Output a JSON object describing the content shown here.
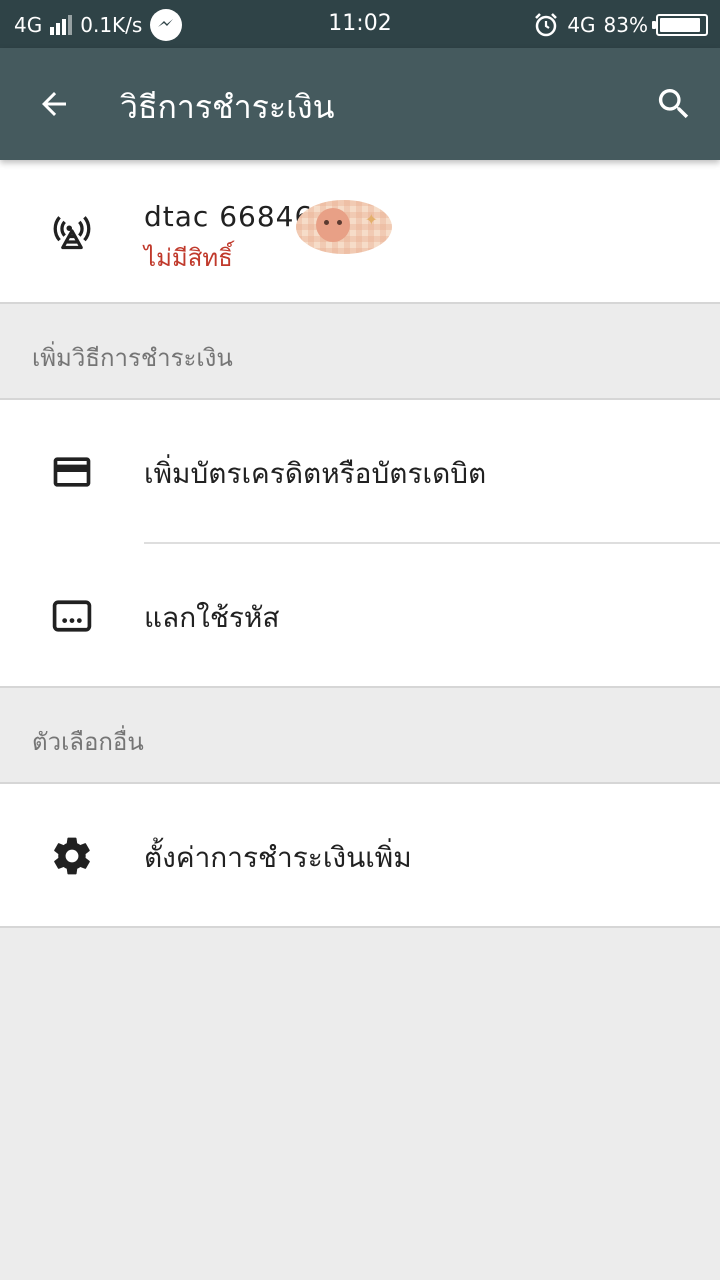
{
  "status_bar": {
    "network_left": "4G",
    "speed": "0.1K/s",
    "messenger_icon": "messenger-icon",
    "time": "11:02",
    "alarm_icon": "alarm-icon",
    "network_right": "4G",
    "battery_text": "83%",
    "battery_level": 0.83
  },
  "app_bar": {
    "title": "วิธีการชำระเงิน",
    "back_icon": "arrow-back-icon",
    "search_icon": "search-icon",
    "background": "#455a5e"
  },
  "carrier": {
    "name": "dtac 668464",
    "status": "ไม่มีสิทธิ์",
    "status_color": "#c0392b",
    "icon": "cell-tower-icon"
  },
  "sections": {
    "add_method_header": "เพิ่มวิธีการชำระเงิน",
    "add_card_label": "เพิ่มบัตรเครดิตหรือบัตรเดบิต",
    "redeem_label": "แลกใช้รหัส",
    "other_header": "ตัวเลือกอื่น",
    "settings_label": "ตั้งค่าการชำระเงินเพิ่ม"
  }
}
